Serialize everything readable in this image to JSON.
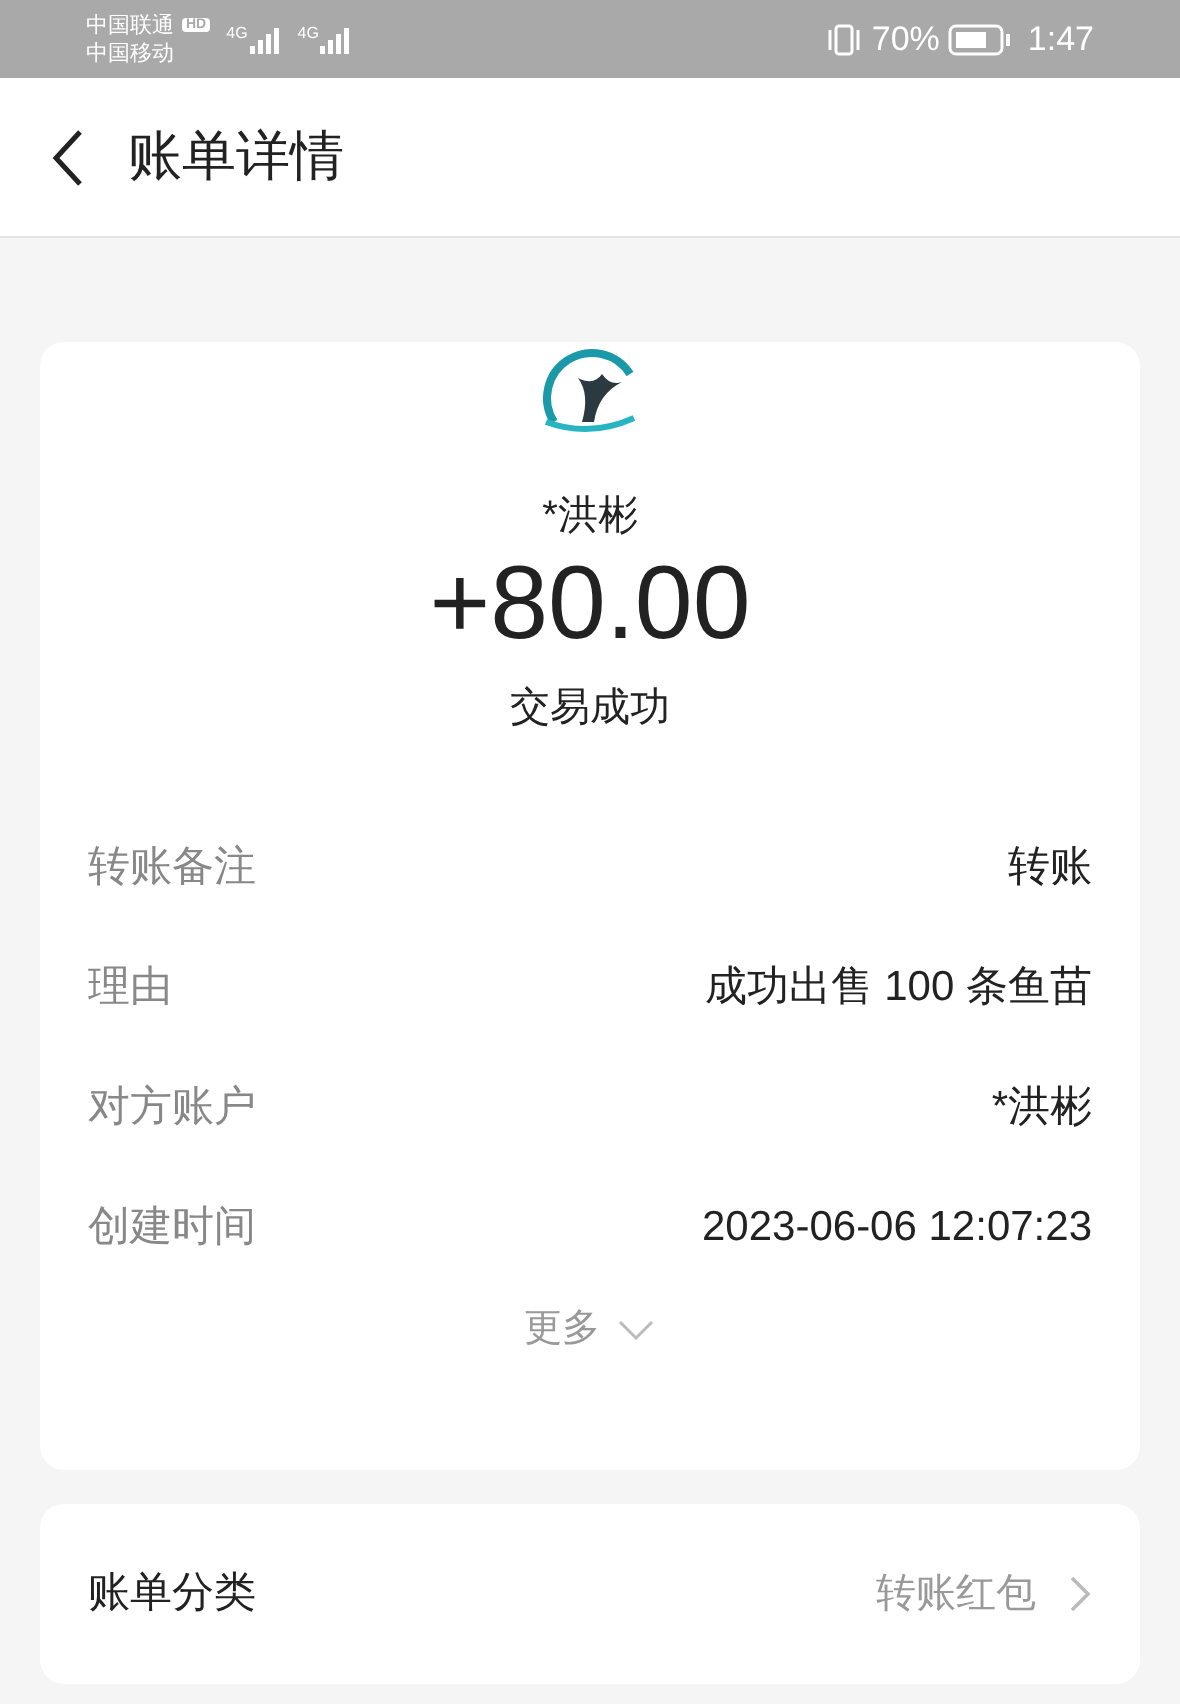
{
  "status_bar": {
    "carriers": [
      "中国联通",
      "中国移动"
    ],
    "hd_badge": "HD",
    "network_labels": [
      "4G",
      "4G"
    ],
    "battery_percent": "70%",
    "time": "1:47"
  },
  "header": {
    "title": "账单详情"
  },
  "summary": {
    "payer": "*洪彬",
    "amount": "+80.00",
    "status": "交易成功"
  },
  "details": [
    {
      "label": "转账备注",
      "value": "转账"
    },
    {
      "label": "理由",
      "value": "成功出售 100 条鱼苗"
    },
    {
      "label": "对方账户",
      "value": "*洪彬"
    },
    {
      "label": "创建时间",
      "value": "2023-06-06 12:07:23"
    }
  ],
  "more": {
    "label": "更多",
    "expanded": false
  },
  "category": {
    "label": "账单分类",
    "value": "转账红包"
  }
}
